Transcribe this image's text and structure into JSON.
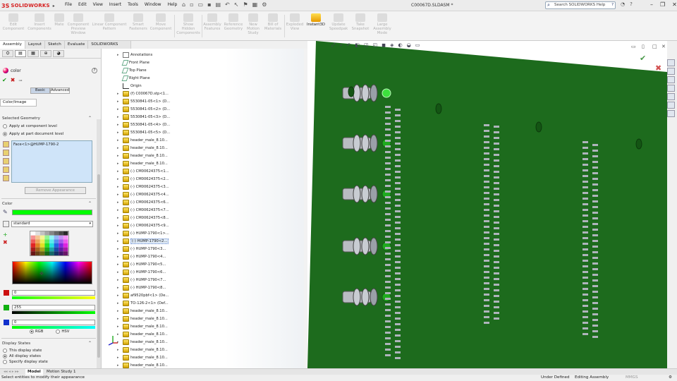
{
  "app": {
    "logo_ds": "3S",
    "logo_name": "SOLIDWORKS",
    "doc_title": "C00067D.SLDASM *"
  },
  "menu": [
    "File",
    "Edit",
    "View",
    "Insert",
    "Tools",
    "Window",
    "Help"
  ],
  "help_search": {
    "placeholder": "Search SOLIDWORKS Help"
  },
  "commands": [
    {
      "label": "Edit\nComponent"
    },
    {
      "label": "Insert\nComponents"
    },
    {
      "label": "Mate"
    },
    {
      "label": "Component\nPreview\nWindow"
    },
    {
      "label": "Linear Component\nPattern"
    },
    {
      "label": "Smart\nFasteners"
    },
    {
      "label": "Move\nComponent"
    },
    {
      "label": "Show\nHidden\nComponents"
    },
    {
      "label": "Assembly\nFeatures"
    },
    {
      "label": "Reference\nGeometry"
    },
    {
      "label": "New\nMotion\nStudy"
    },
    {
      "label": "Bill of\nMaterials"
    },
    {
      "label": "Exploded\nView"
    },
    {
      "label": "Instant3D"
    },
    {
      "label": "Update\nSpeedpak"
    },
    {
      "label": "Take\nSnapshot"
    },
    {
      "label": "Large\nAssembly\nMode"
    }
  ],
  "tabs": [
    "Assembly",
    "Layout",
    "Sketch",
    "Evaluate",
    "SOLIDWORKS Add-Ins"
  ],
  "property_manager": {
    "title": "color",
    "basic_label": "Basic",
    "advanced_label": "Advanced",
    "color_image_tab": "Color/Image",
    "selected_geometry_title": "Selected Geometry",
    "apply_component": "Apply at component level",
    "apply_part": "Apply at part document level",
    "selected_item": "Face<1>@HUMP-1790-2",
    "remove_appearance": "Remove Appearance",
    "color_section": "Color",
    "palette_name": "standard",
    "rgb": [
      {
        "value": "0",
        "color": "#cc1010"
      },
      {
        "value": "255",
        "color": "#10b010"
      },
      {
        "value": "0",
        "color": "#1030cc"
      }
    ],
    "current_color": "#00ff00",
    "model_rgb": "RGB",
    "model_hsv": "HSV",
    "display_states_title": "Display States",
    "ds_this": "This display state",
    "ds_all": "All display states",
    "ds_specify": "Specify display state"
  },
  "tree": [
    {
      "label": "Annotations",
      "icon": "ann",
      "exp": "▸"
    },
    {
      "label": "Front Plane",
      "icon": "plane",
      "exp": ""
    },
    {
      "label": "Top Plane",
      "icon": "plane",
      "exp": ""
    },
    {
      "label": "Right Plane",
      "icon": "plane",
      "exp": ""
    },
    {
      "label": "Origin",
      "icon": "origin",
      "exp": ""
    },
    {
      "label": "(f) C00067D.stp<1...",
      "icon": "comp",
      "exp": "▸"
    },
    {
      "label": "5530841-05<1> (D...",
      "icon": "comp",
      "exp": "▸"
    },
    {
      "label": "5530841-05<2> (D...",
      "icon": "comp",
      "exp": "▸"
    },
    {
      "label": "5530841-05<3> (D...",
      "icon": "comp",
      "exp": "▸"
    },
    {
      "label": "5530841-05<4> (D...",
      "icon": "comp",
      "exp": "▸"
    },
    {
      "label": "5530841-05<5> (D...",
      "icon": "comp",
      "exp": "▸"
    },
    {
      "label": "header_male_8.10...",
      "icon": "comp",
      "exp": "▸"
    },
    {
      "label": "header_male_8.10...",
      "icon": "comp",
      "exp": "▸"
    },
    {
      "label": "header_male_8.10...",
      "icon": "comp",
      "exp": "▸"
    },
    {
      "label": "header_male_8.10...",
      "icon": "comp",
      "exp": "▸"
    },
    {
      "label": "(-) CM00624375<1...",
      "icon": "comp",
      "exp": "▸"
    },
    {
      "label": "(-) CM00624375<2...",
      "icon": "comp",
      "exp": "▸"
    },
    {
      "label": "(-) CM00624375<3...",
      "icon": "comp",
      "exp": "▸"
    },
    {
      "label": "(-) CM00624375<4...",
      "icon": "comp",
      "exp": "▸"
    },
    {
      "label": "(-) CM00624375<6...",
      "icon": "comp",
      "exp": "▸"
    },
    {
      "label": "(-) CM00624375<7...",
      "icon": "comp",
      "exp": "▸"
    },
    {
      "label": "(-) CM00624375<8...",
      "icon": "comp",
      "exp": "▸"
    },
    {
      "label": "(-) CM00624375<9...",
      "icon": "comp",
      "exp": "▸"
    },
    {
      "label": "(-) HUMP-1790<1>...",
      "icon": "comp",
      "exp": "▸"
    },
    {
      "label": "(-) HUMP-1790<2...",
      "icon": "comp",
      "exp": "▸",
      "selected": true
    },
    {
      "label": "(-) HUMP-1790<3...",
      "icon": "comp",
      "exp": "▸"
    },
    {
      "label": "(-) HUMP-1790<4...",
      "icon": "comp",
      "exp": "▸"
    },
    {
      "label": "(-) HUMP-1790<5...",
      "icon": "comp",
      "exp": "▸"
    },
    {
      "label": "(-) HUMP-1790<6...",
      "icon": "comp",
      "exp": "▸"
    },
    {
      "label": "(-) HUMP-1790<7...",
      "icon": "comp",
      "exp": "▸"
    },
    {
      "label": "(-) HUMP-1790<8...",
      "icon": "comp",
      "exp": "▸"
    },
    {
      "label": "af9520pbf<1> (De...",
      "icon": "comp",
      "exp": "▸"
    },
    {
      "label": "TO-126-2<1> (Def...",
      "icon": "comp",
      "exp": "▸"
    },
    {
      "label": "header_male_8.10...",
      "icon": "comp",
      "exp": "▸"
    },
    {
      "label": "header_male_8.10...",
      "icon": "comp",
      "exp": "▸"
    },
    {
      "label": "header_male_8.10...",
      "icon": "comp",
      "exp": "▸"
    },
    {
      "label": "header_male_8.10...",
      "icon": "comp",
      "exp": "▸"
    },
    {
      "label": "header_male_8.10...",
      "icon": "comp",
      "exp": "▸"
    },
    {
      "label": "header_male_8.10...",
      "icon": "comp",
      "exp": "▸"
    },
    {
      "label": "header_male_8.10...",
      "icon": "comp",
      "exp": "▸"
    },
    {
      "label": "header_male_8.10...",
      "icon": "comp",
      "exp": "▸"
    }
  ],
  "bottom_tabs": {
    "model": "Model",
    "motion": "Motion Study 1"
  },
  "status": {
    "message": "Select entities to modify their appearance",
    "defined": "Under Defined",
    "mode": "Editing Assembly",
    "units": "MMGS"
  },
  "colors": {
    "board": "#1d6b1d",
    "accent": "#d62020"
  }
}
